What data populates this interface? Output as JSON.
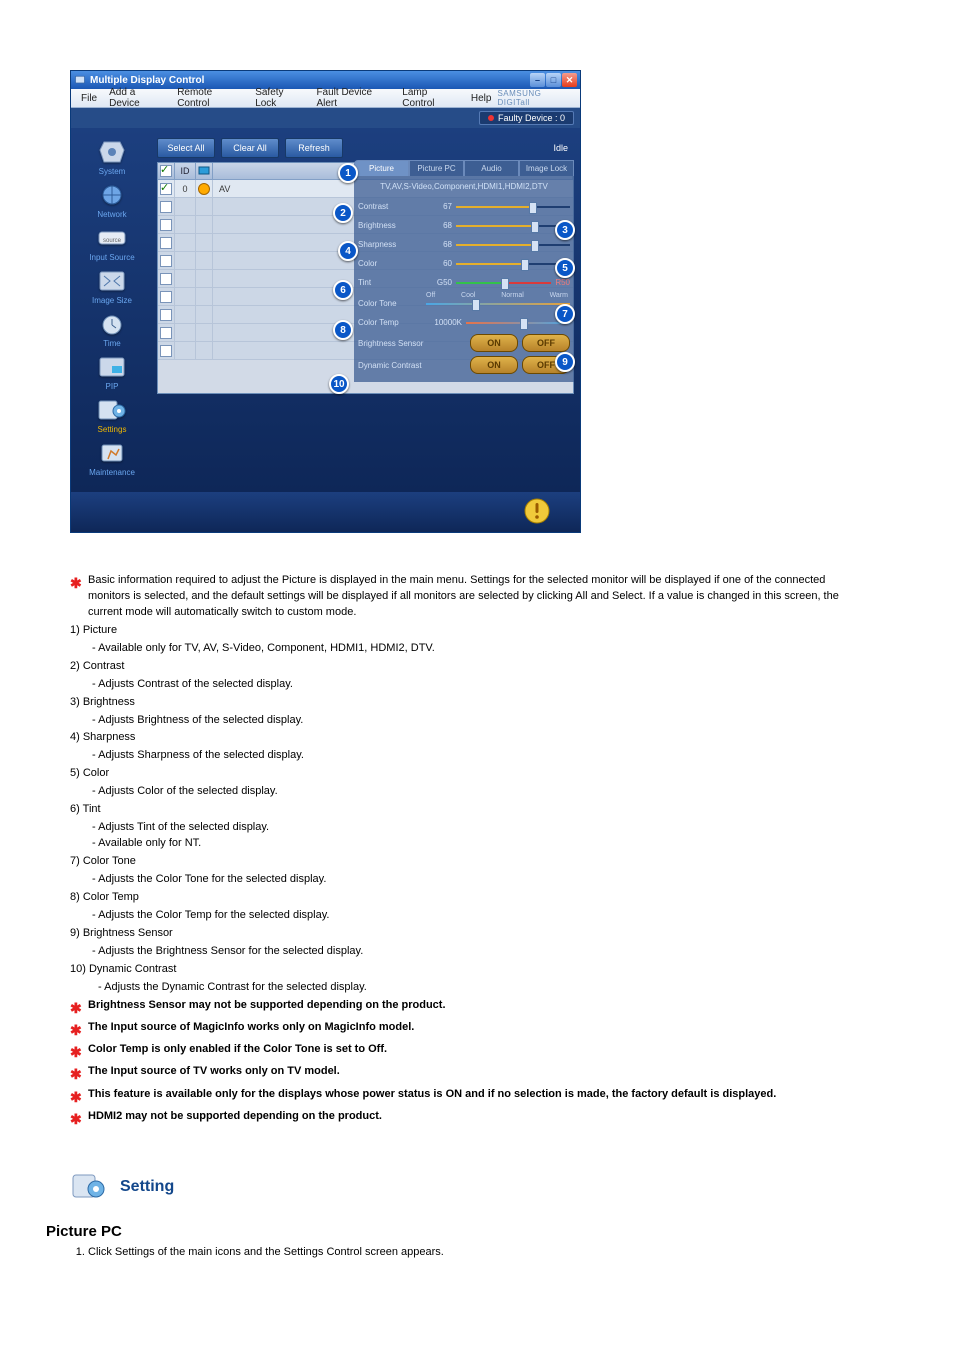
{
  "window": {
    "title": "Multiple Display Control"
  },
  "menu": {
    "file": "File",
    "add": "Add a Device",
    "remote": "Remote Control",
    "safety": "Safety Lock",
    "fault": "Fault Device Alert",
    "lamp": "Lamp Control",
    "help": "Help",
    "brand": "SAMSUNG DIGITall"
  },
  "faulty": "Faulty Device : 0",
  "sidebar": {
    "system": "System",
    "network": "Network",
    "input": "Input Source",
    "imagesize": "Image Size",
    "time": "Time",
    "pip": "PIP",
    "settings": "Settings",
    "maintenance": "Maintenance"
  },
  "toolbar": {
    "selectall": "Select All",
    "clearall": "Clear All",
    "refresh": "Refresh",
    "idle": "Idle"
  },
  "gridhead": {
    "id": "ID",
    "input": "Input"
  },
  "gridrow": {
    "id": "0",
    "input": "AV"
  },
  "tabs": {
    "picture": "Picture",
    "picturepc": "Picture PC",
    "audio": "Audio",
    "imagelock": "Image Lock"
  },
  "panel": {
    "sub": "TV,AV,S-Video,Component,HDMI1,HDMI2,DTV",
    "contrast": {
      "label": "Contrast",
      "value": "67"
    },
    "brightness": {
      "label": "Brightness",
      "value": "68"
    },
    "sharpness": {
      "label": "Sharpness",
      "value": "68"
    },
    "color": {
      "label": "Color",
      "value": "60"
    },
    "tint": {
      "label": "Tint",
      "value": "G50",
      "r": "R50"
    },
    "colortone": {
      "label": "Color Tone",
      "off": "Off",
      "cool": "Cool",
      "normal": "Normal",
      "warm": "Warm"
    },
    "colortemp": {
      "label": "Color Temp",
      "value": "10000K"
    },
    "bsensor": {
      "label": "Brightness Sensor",
      "on": "ON",
      "off": "OFF"
    },
    "dcontrast": {
      "label": "Dynamic Contrast",
      "on": "ON",
      "off": "OFF"
    }
  },
  "doc": {
    "intro": "Basic information required to adjust the Picture is displayed in the main menu. Settings for the selected monitor will be displayed if one of the connected monitors is selected, and the default settings will be displayed if all monitors are selected by clicking All and Select. If a value is changed in this screen, the current mode will automatically switch to custom mode.",
    "n1t": "Picture",
    "n1d": "- Available only for TV, AV, S-Video, Component, HDMI1, HDMI2, DTV.",
    "n2t": "Contrast",
    "n2d": "- Adjusts Contrast of the selected display.",
    "n3t": "Brightness",
    "n3d": "- Adjusts Brightness of the selected display.",
    "n4t": "Sharpness",
    "n4d": "- Adjusts Sharpness of the selected display.",
    "n5t": "Color",
    "n5d": "- Adjusts Color of the selected display.",
    "n6t": "Tint",
    "n6d1": "- Adjusts Tint of the selected display.",
    "n6d2": "- Available  only for NT.",
    "n7t": "Color Tone",
    "n7d": "- Adjusts the Color Tone for the selected display.",
    "n8t": "Color Temp",
    "n8d": "- Adjusts the Color Temp for the selected display.",
    "n9t": "Brightness Sensor",
    "n9d": "- Adjusts the Brightness Sensor for the selected display.",
    "n10t": "Dynamic Contrast",
    "n10d": "- Adjusts the Dynamic Contrast for the selected display.",
    "s1": "Brightness Sensor may not be supported depending on the product.",
    "s2": "The Input source of MagicInfo works only on MagicInfo model.",
    "s3": "Color Temp is only enabled if the Color Tone is set to Off.",
    "s4": "The Input source of TV works only on TV model.",
    "s5": "This feature is available only for the displays whose power status is ON and if no selection is made, the factory default is displayed.",
    "s6": "HDMI2 may not be supported depending on the product.",
    "setting_heading": "Setting",
    "picturepc_heading": "Picture PC",
    "step1": "Click Settings of the main icons and the Settings Control screen appears."
  }
}
